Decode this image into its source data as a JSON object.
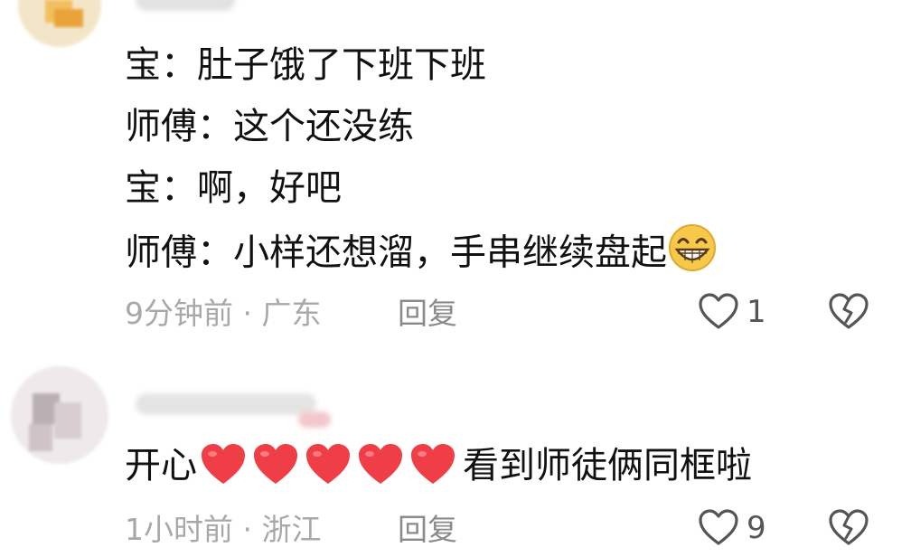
{
  "comment1": {
    "lines": [
      {
        "speaker": "宝",
        "sep": "：",
        "text": "肚子饿了下班下班"
      },
      {
        "speaker": "师傅",
        "sep": "：",
        "text": "这个还没练"
      },
      {
        "speaker": "宝",
        "sep": "：",
        "text": "啊，好吧"
      },
      {
        "speaker": "师傅",
        "sep": "：",
        "text": "小样还想溜，手串继续盘起",
        "emoji": "grinning-face-icon"
      }
    ],
    "meta": "9分钟前 · 广东",
    "reply_label": "回复",
    "like_count": "1"
  },
  "comment2": {
    "text_before": "开心",
    "hearts": 5,
    "text_after": "看到师徒俩同框啦",
    "meta": "1小时前 · 浙江",
    "reply_label": "回复",
    "like_count": "9"
  },
  "colors": {
    "text": "#111111",
    "meta": "#a8a8a8",
    "icon": "#555555",
    "heart": "#f03e46",
    "emoji": "#f6c94a"
  }
}
